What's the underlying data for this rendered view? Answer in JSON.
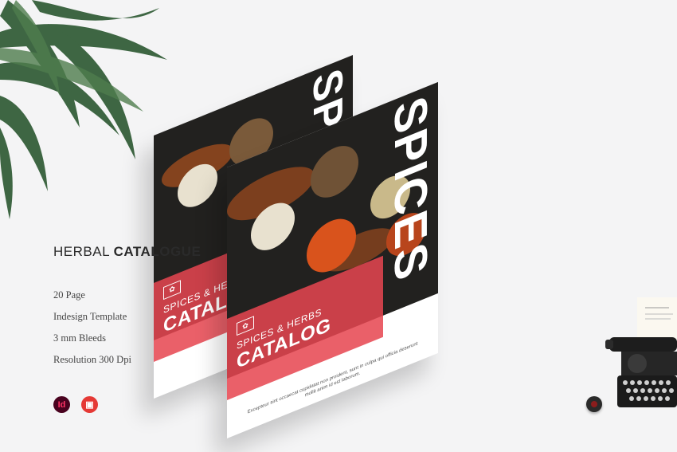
{
  "heading": {
    "light": "HERBAL",
    "bold": "CATALOGUE"
  },
  "features": [
    "20 Page",
    "Indesign Template",
    "3 mm Bleeds",
    "Resolution 300 Dpi"
  ],
  "badges": {
    "indesign": "Id",
    "pdf": "▣"
  },
  "cover": {
    "big_word": "SPICES",
    "subtitle": "SPICES & HERBS",
    "title": "CATALOG",
    "blurb": "Excepteur sint occaecat cupidatat non proident, sunt in culpa qui officia deserunt mollit anim id est laborum."
  },
  "colors": {
    "accent_red": "#e64650",
    "background": "#f4f4f5",
    "photo_dark": "#22211f"
  }
}
